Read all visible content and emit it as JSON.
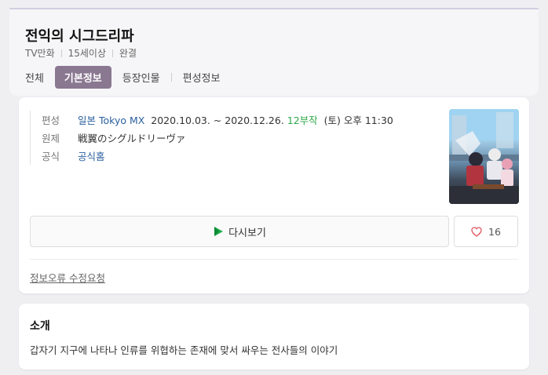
{
  "title": "전익의 시그드리파",
  "meta": [
    "TV만화",
    "15세이상",
    "완결"
  ],
  "tabs": [
    {
      "label": "전체",
      "active": false
    },
    {
      "label": "기본정보",
      "active": true
    },
    {
      "label": "등장인물",
      "active": false
    },
    {
      "label": "편성정보",
      "active": false
    }
  ],
  "info": {
    "broadcast_label": "편성",
    "broadcast_country": "일본",
    "broadcast_channel": "Tokyo MX",
    "broadcast_period": "2020.10.03. ~ 2020.12.26.",
    "broadcast_episodes": "12부작",
    "broadcast_time": "(토) 오후 11:30",
    "original_label": "원제",
    "original_title": "戦翼のシグルドリーヴァ",
    "official_label": "공식",
    "official_link": "공식홈"
  },
  "actions": {
    "rewatch_label": "다시보기",
    "like_count": "16"
  },
  "report_link": "정보오류 수정요청",
  "intro": {
    "heading": "소개",
    "text": "갑자기 지구에 나타나 인류를 위협하는 존재에 맞서 싸우는 전사들의 이야기"
  },
  "colors": {
    "active_tab": "#8a7790",
    "link": "#2a5f9e",
    "episodes_green": "#2ea84a",
    "heart": "#e05a63"
  },
  "icons": {
    "play": "play-icon",
    "heart": "heart-icon"
  }
}
